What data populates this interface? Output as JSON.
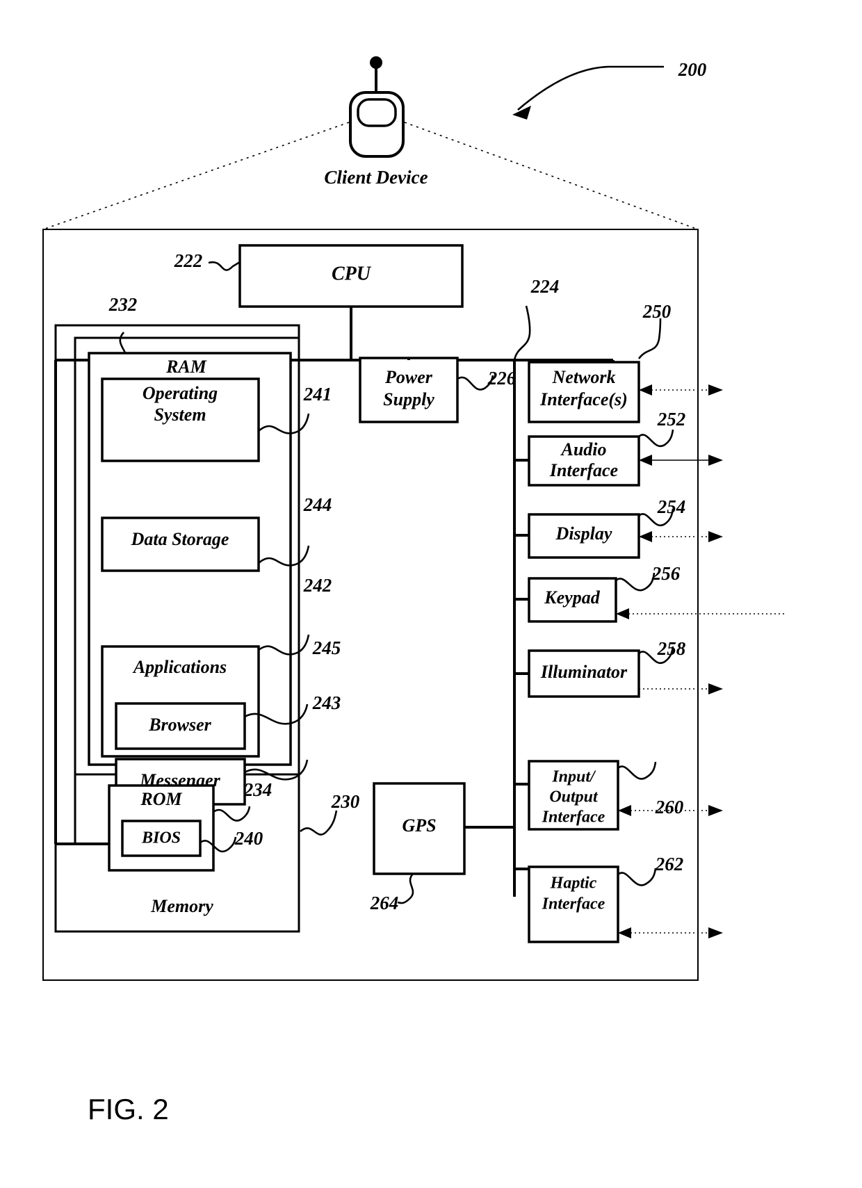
{
  "figure": {
    "caption": "FIG. 2",
    "overall_ref": "200",
    "device_caption": "Client Device"
  },
  "blocks": {
    "cpu": {
      "label": "CPU",
      "ref": "222"
    },
    "power_supply": {
      "label": "Power\nSupply",
      "line1": "Power",
      "line2": "Supply",
      "ref": "226"
    },
    "memory": {
      "label": "Memory",
      "ref": "230"
    },
    "memory_bus": {
      "ref": "232"
    },
    "ram": {
      "label": "RAM"
    },
    "operating_system": {
      "line1": "Operating",
      "line2": "System",
      "ref": "241"
    },
    "data_storage": {
      "label": "Data Storage",
      "ref": "244"
    },
    "applications": {
      "label": "Applications",
      "ref": "242"
    },
    "browser": {
      "label": "Browser",
      "ref": "245"
    },
    "messenger": {
      "label": "Messenger",
      "ref": "243"
    },
    "rom": {
      "label": "ROM",
      "ref": "234"
    },
    "bios": {
      "label": "BIOS",
      "ref": "240"
    },
    "gps": {
      "label": "GPS",
      "ref": "264"
    },
    "io_bus": {
      "ref": "224"
    },
    "network_interface": {
      "line1": "Network",
      "line2": "Interface(s)",
      "ref": "250"
    },
    "audio_interface": {
      "line1": "Audio",
      "line2": "Interface",
      "ref": "252"
    },
    "display": {
      "label": "Display",
      "ref": "254"
    },
    "keypad": {
      "label": "Keypad",
      "ref": "256"
    },
    "illuminator": {
      "label": "Illuminator",
      "ref": "258"
    },
    "io_interface": {
      "line1": "Input/",
      "line2": "Output",
      "line3": "Interface",
      "ref": "260"
    },
    "haptic_interface": {
      "line1": "Haptic",
      "line2": "Interface",
      "ref": "262"
    }
  },
  "colors": {
    "ink": "#000000",
    "paper": "#ffffff"
  }
}
